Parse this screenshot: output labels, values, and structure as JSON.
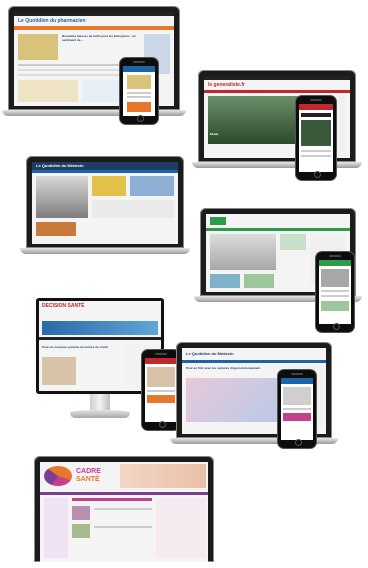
{
  "colors": {
    "accent_blue": "#1d63a8",
    "accent_orange": "#e8772e",
    "accent_red": "#c1272d",
    "accent_green": "#2e9b4b",
    "accent_pink": "#c2418a",
    "accent_purple": "#7b3f8e"
  },
  "devices": [
    {
      "id": "quotidien-pharmacien",
      "logo": "Le Quotidien du pharmacien",
      "headline": "Nouvelles baisses de tarifs pour les biologistes : un sentiment de…"
    },
    {
      "id": "le-generaliste",
      "logo": "le generaliste.fr",
      "headline": "Ebola"
    },
    {
      "id": "le-quotidien-du-medecin",
      "logo": "Le Quotidien du Médecin"
    },
    {
      "id": "decision-sante-cabinet",
      "logo": ""
    },
    {
      "id": "decision-sante",
      "logo": "DECISION SANTÉ",
      "headline": "Pour un nouveau système de lecture du crédit"
    },
    {
      "id": "quotidien-medecin-2",
      "logo": "Le Quotidien du Médecin",
      "headline": "Pour en finir avec les ruptures d'approvisionnement"
    },
    {
      "id": "cadre-sante",
      "logo_line1": "CADRE",
      "logo_line2": "SANTÉ"
    }
  ]
}
